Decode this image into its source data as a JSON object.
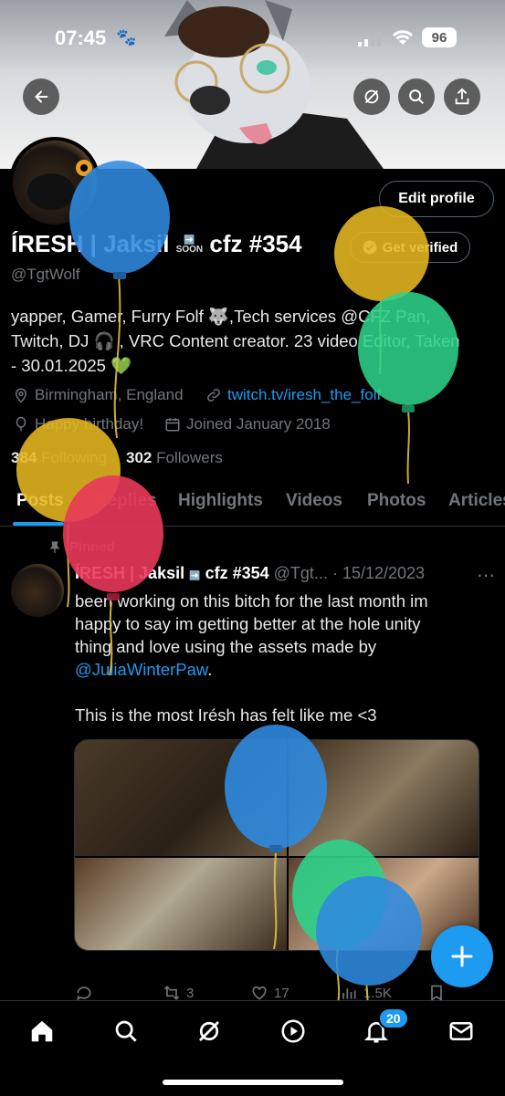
{
  "status_bar": {
    "time": "07:45",
    "battery": "96"
  },
  "header_actions": {
    "back": "back-arrow-icon",
    "grok": "grok-icon",
    "search": "search-icon",
    "share": "share-icon"
  },
  "profile": {
    "edit_label": "Edit profile",
    "name_part1": "ÍRESH | Jaksil",
    "soon_label": "SOON",
    "name_part2": "cfz #354",
    "verify_label": "Get verified",
    "handle": "@TgtWolf",
    "bio_line1": "yapper, Gamer, Furry Folf 🐺,Tech services @CFZ Pan,",
    "bio_line2": "Twitch, DJ 🎧 , VRC Content creator. 23 video Editor, Taken",
    "bio_line3": "- 30.01.2025 💚",
    "location": "Birmingham, England",
    "website": "twitch.tv/iresh_the_folf",
    "birthday": "Happy birthday!",
    "joined": "Joined January 2018",
    "following_count": "384",
    "following_label": "Following",
    "followers_count": "302",
    "followers_label": "Followers"
  },
  "tabs": [
    "Posts",
    "Replies",
    "Highlights",
    "Videos",
    "Photos",
    "Articles"
  ],
  "post": {
    "pinned_label": "Pinned",
    "author_part1": "ÍRESH | Jaksil",
    "author_part2": "cfz #354",
    "handle": "@Tgt...",
    "date": "· 15/12/2023",
    "text_line1": "been working on this bitch for the last month im",
    "text_line2": "happy to say im getting better at the hole unity",
    "text_line3": "thing and love using the assets made by",
    "mention": "@JuliaWinterPaw",
    "text_line3_end": ".",
    "text_line4": "This is the most Irésh has felt like me <3",
    "retweets": "3",
    "likes": "17",
    "views": "1.5K"
  },
  "nav": {
    "notifications_badge": "20"
  },
  "colors": {
    "accent": "#1d9bf0",
    "background": "#000000",
    "muted": "#71767b"
  }
}
